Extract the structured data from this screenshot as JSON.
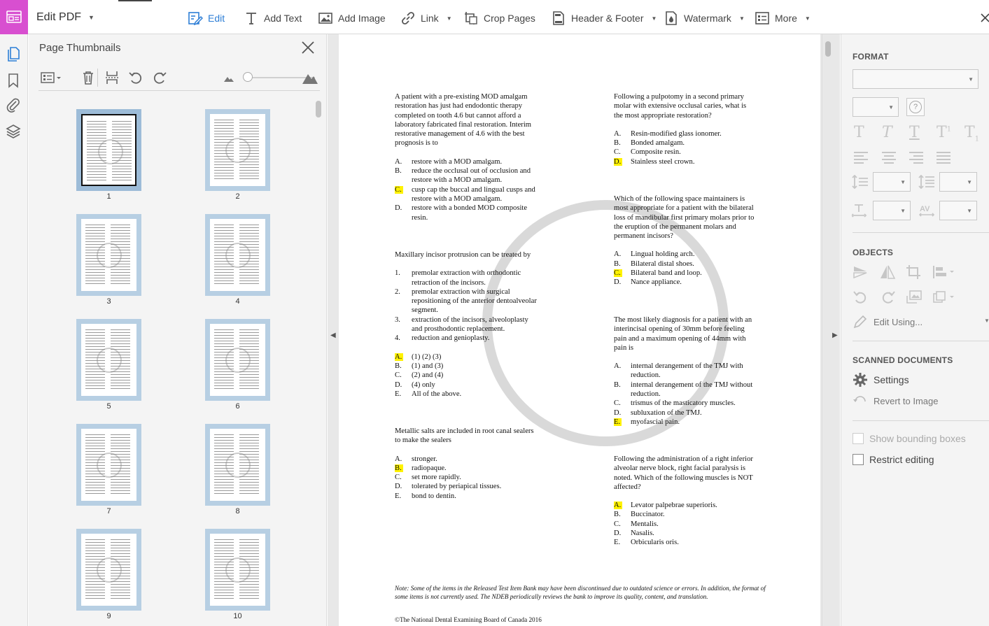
{
  "toolbar": {
    "title": "Edit PDF",
    "tools": [
      {
        "label": "Edit",
        "icon": "edit-text-icon"
      },
      {
        "label": "Add Text",
        "icon": "add-text-icon"
      },
      {
        "label": "Add Image",
        "icon": "add-image-icon"
      },
      {
        "label": "Link",
        "icon": "link-icon"
      },
      {
        "label": "Crop Pages",
        "icon": "crop-pages-icon"
      },
      {
        "label": "Header & Footer",
        "icon": "header-footer-icon"
      },
      {
        "label": "Watermark",
        "icon": "watermark-icon"
      },
      {
        "label": "More",
        "icon": "more-icon"
      }
    ]
  },
  "thumbnails": {
    "title": "Page Thumbnails",
    "pages": [
      "1",
      "2",
      "3",
      "4",
      "5",
      "6",
      "7",
      "8",
      "9",
      "10"
    ]
  },
  "document": {
    "questions": [
      {
        "stem": "A patient with a pre-existing MOD amalgam\nrestoration has just had endodontic therapy\ncompleted on tooth 4.6 but cannot afford a\nlaboratory fabricated final restoration. Interim\nrestorative management of 4.6 with the best\nprognosis is to",
        "options": [
          {
            "letter": "A.",
            "text": "restore with a MOD amalgam.",
            "correct": false
          },
          {
            "letter": "B.",
            "text": "reduce the occlusal out of occlusion and\nrestore with a MOD amalgam.",
            "correct": false
          },
          {
            "letter": "C.",
            "text": "cusp cap the buccal and lingual cusps and\nrestore with a MOD amalgam.",
            "correct": true
          },
          {
            "letter": "D.",
            "text": "restore with a bonded MOD composite\nresin.",
            "correct": false
          }
        ]
      },
      {
        "stem": "Maxillary incisor protrusion can be treated by",
        "numbered": [
          {
            "letter": "1.",
            "text": "premolar extraction with orthodontic\nretraction of the incisors."
          },
          {
            "letter": "2.",
            "text": "premolar extraction with surgical\nrepositioning of the anterior dentoalveolar\nsegment."
          },
          {
            "letter": "3.",
            "text": "extraction of the incisors, alveoloplasty\nand prosthodontic replacement."
          },
          {
            "letter": "4.",
            "text": "reduction and genioplasty."
          }
        ],
        "options": [
          {
            "letter": "A.",
            "text": "(1) (2) (3)",
            "correct": true
          },
          {
            "letter": "B.",
            "text": "(1) and (3)",
            "correct": false
          },
          {
            "letter": "C.",
            "text": "(2) and (4)",
            "correct": false
          },
          {
            "letter": "D.",
            "text": "(4) only",
            "correct": false
          },
          {
            "letter": "E.",
            "text": "All of the above.",
            "correct": false
          }
        ]
      },
      {
        "stem": "Metallic salts are included in root canal sealers\nto make the sealers",
        "options": [
          {
            "letter": "A.",
            "text": "stronger.",
            "correct": false
          },
          {
            "letter": "B.",
            "text": "radiopaque.",
            "correct": true
          },
          {
            "letter": "C.",
            "text": "set more rapidly.",
            "correct": false
          },
          {
            "letter": "D.",
            "text": "tolerated by periapical tissues.",
            "correct": false
          },
          {
            "letter": "E.",
            "text": "bond to dentin.",
            "correct": false
          }
        ]
      },
      {
        "stem": "Following a pulpotomy in a second primary\nmolar with extensive occlusal caries, what is\nthe most appropriate restoration?",
        "options": [
          {
            "letter": "A.",
            "text": "Resin-modified glass ionomer.",
            "correct": false
          },
          {
            "letter": "B.",
            "text": "Bonded amalgam.",
            "correct": false
          },
          {
            "letter": "C.",
            "text": "Composite resin.",
            "correct": false
          },
          {
            "letter": "D.",
            "text": "Stainless steel crown.",
            "correct": true
          }
        ]
      },
      {
        "stem": "Which of the following space maintainers is\nmost appropriate for a patient with the bilateral\nloss of mandibular first primary molars prior to\nthe eruption of the permanent molars and\npermanent incisors?",
        "options": [
          {
            "letter": "A.",
            "text": "Lingual holding arch.",
            "correct": false
          },
          {
            "letter": "B.",
            "text": "Bilateral distal shoes.",
            "correct": false
          },
          {
            "letter": "C.",
            "text": "Bilateral band and loop.",
            "correct": true
          },
          {
            "letter": "D.",
            "text": "Nance appliance.",
            "correct": false
          }
        ]
      },
      {
        "stem": "The most likely diagnosis for a patient with an\ninterincisal opening of 30mm before feeling\npain and a maximum opening of 44mm with\npain is",
        "options": [
          {
            "letter": "A.",
            "text": "internal derangement of the TMJ with\nreduction.",
            "correct": false
          },
          {
            "letter": "B.",
            "text": "internal derangement of the TMJ without\nreduction.",
            "correct": false
          },
          {
            "letter": "C.",
            "text": "trismus of the masticatory muscles.",
            "correct": false
          },
          {
            "letter": "D.",
            "text": "subluxation of the TMJ.",
            "correct": false
          },
          {
            "letter": "E.",
            "text": "myofascial pain.",
            "correct": true
          }
        ]
      },
      {
        "stem": "Following the administration of a right inferior\nalveolar nerve block, right facial paralysis is\nnoted.  Which of the following muscles is NOT\naffected?",
        "options": [
          {
            "letter": "A.",
            "text": "Levator palpebrae superioris.",
            "correct": true
          },
          {
            "letter": "B.",
            "text": "Buccinator.",
            "correct": false
          },
          {
            "letter": "C.",
            "text": "Mentalis.",
            "correct": false
          },
          {
            "letter": "D.",
            "text": "Nasalis.",
            "correct": false
          },
          {
            "letter": "E.",
            "text": "Orbicularis oris.",
            "correct": false
          }
        ]
      }
    ],
    "note": "Note:  Some of the items in the Released Test Item Bank may have been discontinued due to outdated science or errors. In addition, the format of some items is not currently used. The NDEB periodically reviews the bank to improve its quality, content, and translation.",
    "copyright": "©The National Dental Examining Board of Canada 2016"
  },
  "right_panel": {
    "format_title": "FORMAT",
    "objects_title": "OBJECTS",
    "edit_using": "Edit Using...",
    "scanned_title": "SCANNED DOCUMENTS",
    "settings": "Settings",
    "revert": "Revert to Image",
    "show_bounding_boxes": "Show bounding boxes",
    "restrict_editing": "Restrict editing",
    "help_glyph": "?"
  },
  "colors": {
    "app_tile": "#d84fd0",
    "accent": "#2d7ed6",
    "highlight": "#fff200",
    "thumb_frame": "#b7cfe3"
  }
}
